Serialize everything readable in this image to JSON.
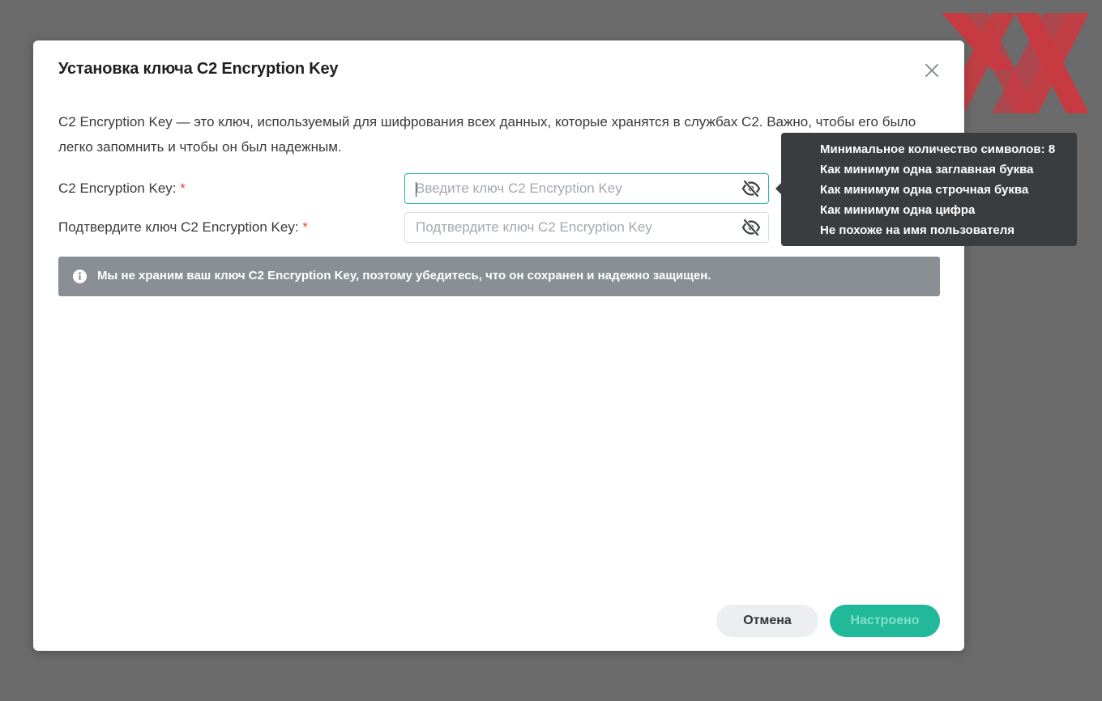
{
  "dialog": {
    "title": "Установка ключа C2 Encryption Key",
    "description": "C2 Encryption Key — это ключ, используемый для шифрования всех данных, которые хранятся в службах C2. Важно, чтобы его было легко запомнить и чтобы он был надежным."
  },
  "form": {
    "key_label": "C2 Encryption Key:",
    "key_placeholder": "Введите ключ C2 Encryption Key",
    "key_value": "",
    "confirm_label": "Подтвердите ключ C2 Encryption Key:",
    "confirm_placeholder": "Подтвердите ключ C2 Encryption Key",
    "confirm_value": "",
    "required_mark": "*"
  },
  "info_banner": {
    "text": "Мы не храним ваш ключ C2 Encryption Key, поэтому убедитесь, что он сохранен и надежно защищен."
  },
  "tooltip": {
    "requirements": [
      "Минимальное количество символов: 8",
      "Как минимум одна заглавная буква",
      "Как минимум одна строчная буква",
      "Как минимум одна цифра",
      "Не похоже на имя пользователя"
    ]
  },
  "buttons": {
    "cancel": "Отмена",
    "submit": "Настроено"
  },
  "icons": {
    "close": "close-icon",
    "eye": "eye-off-icon",
    "info": "info-icon"
  },
  "colors": {
    "accent": "#22b99a",
    "required": "#e0453a",
    "banner": "#8a8f95",
    "tooltip": "#3a3d40"
  }
}
